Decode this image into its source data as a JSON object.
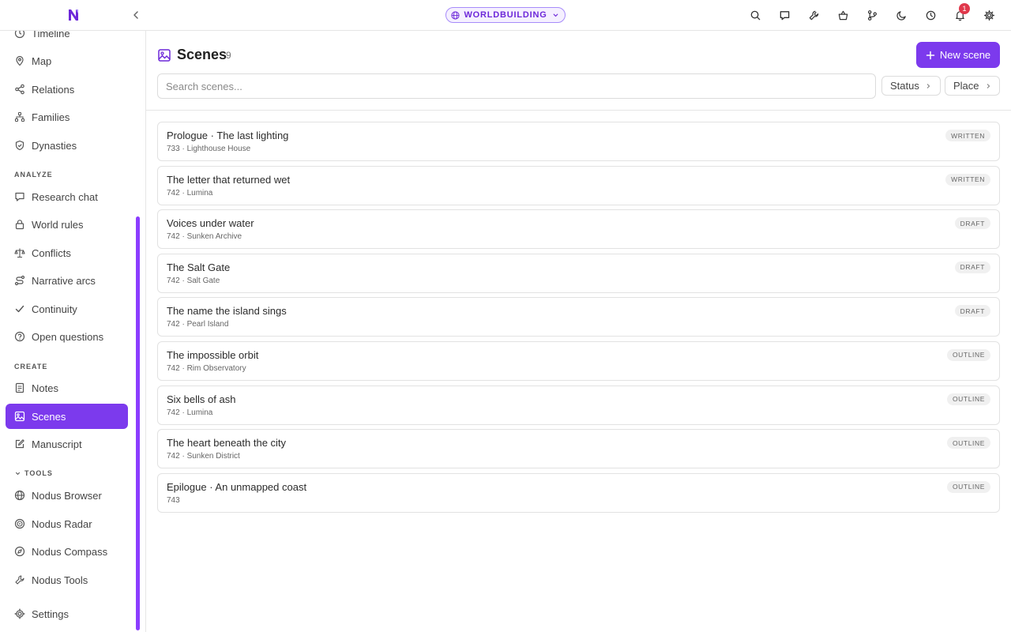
{
  "topbar": {
    "mode_label": "WORLDBUILDING",
    "notification_count": "1",
    "icons": [
      "search-icon",
      "chat-icon",
      "wrench-icon",
      "basket-icon",
      "git-branch-icon",
      "moon-icon",
      "clock-icon",
      "bell-icon",
      "gear-icon"
    ]
  },
  "sidebar": {
    "items_top": [
      {
        "label": "Timeline",
        "icon": "clock-icon"
      },
      {
        "label": "Map",
        "icon": "map-pin-icon"
      },
      {
        "label": "Relations",
        "icon": "share-icon"
      },
      {
        "label": "Families",
        "icon": "tree-icon"
      },
      {
        "label": "Dynasties",
        "icon": "shield-icon"
      }
    ],
    "analyze_label": "ANALYZE",
    "analyze_items": [
      {
        "label": "Research chat",
        "icon": "chat-icon"
      },
      {
        "label": "World rules",
        "icon": "lock-icon"
      },
      {
        "label": "Conflicts",
        "icon": "scales-icon"
      },
      {
        "label": "Narrative arcs",
        "icon": "route-icon"
      },
      {
        "label": "Continuity",
        "icon": "check-icon"
      },
      {
        "label": "Open questions",
        "icon": "question-icon"
      }
    ],
    "create_label": "CREATE",
    "create_items": [
      {
        "label": "Notes",
        "icon": "note-icon"
      },
      {
        "label": "Scenes",
        "icon": "image-icon",
        "active": true
      },
      {
        "label": "Manuscript",
        "icon": "edit-icon"
      }
    ],
    "tools_label": "TOOLS",
    "tools_items": [
      {
        "label": "Nodus Browser",
        "icon": "globe-icon"
      },
      {
        "label": "Nodus Radar",
        "icon": "radar-icon"
      },
      {
        "label": "Nodus Compass",
        "icon": "compass-icon"
      },
      {
        "label": "Nodus Tools",
        "icon": "wrench-icon"
      }
    ],
    "settings_label": "Settings"
  },
  "main": {
    "title": "Scenes",
    "count": "9",
    "new_button": "New scene",
    "search_placeholder": "Search scenes...",
    "filters": [
      "Status",
      "Place"
    ],
    "scenes": [
      {
        "title": "Prologue · The last lighting",
        "meta": "733 · Lighthouse House",
        "status": "WRITTEN"
      },
      {
        "title": "The letter that returned wet",
        "meta": "742 · Lumina",
        "status": "WRITTEN"
      },
      {
        "title": "Voices under water",
        "meta": "742 · Sunken Archive",
        "status": "DRAFT"
      },
      {
        "title": "The Salt Gate",
        "meta": "742 · Salt Gate",
        "status": "DRAFT"
      },
      {
        "title": "The name the island sings",
        "meta": "742 · Pearl Island",
        "status": "DRAFT"
      },
      {
        "title": "The impossible orbit",
        "meta": "742 · Rim Observatory",
        "status": "OUTLINE"
      },
      {
        "title": "Six bells of ash",
        "meta": "742 · Lumina",
        "status": "OUTLINE"
      },
      {
        "title": "The heart beneath the city",
        "meta": "742 · Sunken District",
        "status": "OUTLINE"
      },
      {
        "title": "Epilogue · An unmapped coast",
        "meta": "743",
        "status": "OUTLINE"
      }
    ]
  },
  "colors": {
    "accent": "#7c3aed",
    "badge": "#e0384b"
  }
}
